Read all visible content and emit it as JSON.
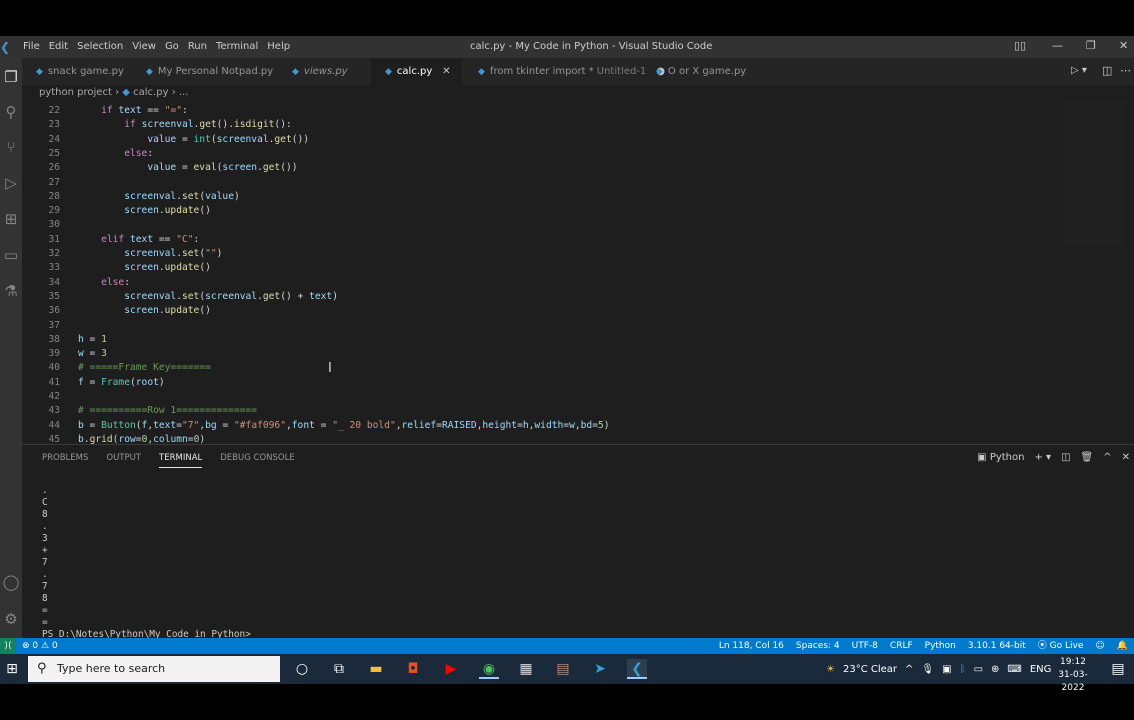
{
  "window": {
    "title": "calc.py - My Code in Python - Visual Studio Code",
    "menu": [
      "File",
      "Edit",
      "Selection",
      "View",
      "Go",
      "Run",
      "Terminal",
      "Help"
    ]
  },
  "tabs": [
    {
      "label": "snack game.py",
      "state": ""
    },
    {
      "label": "My Personal Notpad.py",
      "state": ""
    },
    {
      "label": "views.py",
      "state": ""
    },
    {
      "label": "calc.py",
      "state": "active"
    },
    {
      "label": "from tkinter import *",
      "extra": "Untitled-1",
      "state": "unsaved"
    },
    {
      "label": "O or X game.py",
      "state": ""
    }
  ],
  "breadcrumb": {
    "folder": "python project",
    "file": "calc.py",
    "more": "..."
  },
  "editor": {
    "lines": [
      {
        "n": "22",
        "html": "    <span class='kw'>if</span> <span class='var'>text</span> == <span class='str'>\"=\"</span>:"
      },
      {
        "n": "23",
        "html": "        <span class='kw'>if</span> <span class='var'>screenval</span>.<span class='fn'>get</span>().<span class='fn'>isdigit</span>():"
      },
      {
        "n": "24",
        "html": "            <span class='var'>value</span> = <span class='bi'>int</span>(<span class='var'>screenval</span>.<span class='fn'>get</span>())"
      },
      {
        "n": "25",
        "html": "        <span class='kw'>else</span>:"
      },
      {
        "n": "26",
        "html": "            <span class='var'>value</span> = <span class='fn'>eval</span>(<span class='var'>screen</span>.<span class='fn'>get</span>())"
      },
      {
        "n": "27",
        "html": ""
      },
      {
        "n": "28",
        "html": "        <span class='var'>screenval</span>.<span class='fn'>set</span>(<span class='var'>value</span>)"
      },
      {
        "n": "29",
        "html": "        <span class='var'>screen</span>.<span class='fn'>update</span>()"
      },
      {
        "n": "30",
        "html": ""
      },
      {
        "n": "31",
        "html": "    <span class='kw'>elif</span> <span class='var'>text</span> == <span class='str'>\"C\"</span>:"
      },
      {
        "n": "32",
        "html": "        <span class='var'>screenval</span>.<span class='fn'>set</span>(<span class='str'>\"\"</span>)"
      },
      {
        "n": "33",
        "html": "        <span class='var'>screen</span>.<span class='fn'>update</span>()"
      },
      {
        "n": "34",
        "html": "    <span class='kw'>else</span>:"
      },
      {
        "n": "35",
        "html": "        <span class='var'>screenval</span>.<span class='fn'>set</span>(<span class='var'>screenval</span>.<span class='fn'>get</span>() + <span class='var'>text</span>)"
      },
      {
        "n": "36",
        "html": "        <span class='var'>screen</span>.<span class='fn'>update</span>()"
      },
      {
        "n": "37",
        "html": ""
      },
      {
        "n": "38",
        "html": "<span class='var'>h</span> = <span class='num'>1</span>"
      },
      {
        "n": "39",
        "html": "<span class='var'>w</span> = <span class='num'>3</span>"
      },
      {
        "n": "40",
        "html": "<span class='cm'># =====Frame Key=======</span>"
      },
      {
        "n": "41",
        "html": "<span class='var'>f</span> = <span class='cls'>Frame</span>(<span class='var'>root</span>)"
      },
      {
        "n": "42",
        "html": ""
      },
      {
        "n": "43",
        "html": "<span class='cm'># ==========Row 1==============</span>"
      },
      {
        "n": "44",
        "html": "<span class='var'>b</span> = <span class='cls'>Button</span>(<span class='var'>f</span>,<span class='var'>text</span>=<span class='str'>\"7\"</span>,<span class='var'>bg</span> = <span class='str'>\"#faf096\"</span>,<span class='var'>font</span> = <span class='str'>\"_ 20 bold\"</span>,<span class='var'>relief</span>=<span class='var'>RAISED</span>,<span class='var'>height</span>=<span class='var'>h</span>,<span class='var'>width</span>=<span class='var'>w</span>,<span class='var'>bd</span>=<span class='num'>5</span>)"
      },
      {
        "n": "45",
        "html": "<span class='var'>b</span>.<span class='fn'>grid</span>(<span class='var'>row</span>=<span class='num'>0</span>,<span class='var'>column</span>=<span class='num'>0</span>)"
      }
    ]
  },
  "panel": {
    "tabs": [
      "PROBLEMS",
      "OUTPUT",
      "TERMINAL",
      "DEBUG CONSOLE"
    ],
    "active_tab": "TERMINAL",
    "shell": "Python",
    "terminal_lines": [
      ".",
      "C",
      "8",
      ".",
      "3",
      "+",
      "7",
      ".",
      "7",
      "8",
      "=",
      "=",
      "PS D:\\Notes\\Python\\My Code in Python>"
    ]
  },
  "statusbar": {
    "errors": "0",
    "warnings": "0",
    "right": [
      "Ln 118, Col 16",
      "Spaces: 4",
      "UTF-8",
      "CRLF",
      "Python",
      "3.10.1 64-bit",
      "Go Live"
    ]
  },
  "taskbar": {
    "search_placeholder": "Type here to search",
    "weather": "23°C  Clear",
    "language": "ENG",
    "time": "19:12",
    "date": "31-03-2022"
  },
  "colors": {
    "accent": "#007acc",
    "editor_bg": "#1e1e1e",
    "taskbar": "#1a2a3a"
  }
}
